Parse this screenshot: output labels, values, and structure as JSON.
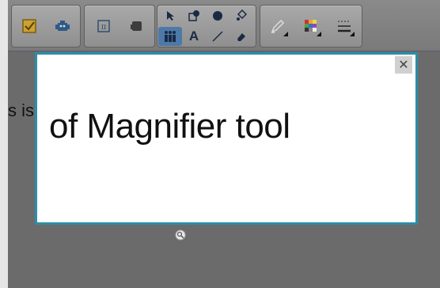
{
  "background": {
    "partial_text": "s is"
  },
  "magnifier": {
    "text": "of Magnifier tool",
    "close_symbol": "✕"
  },
  "toolbar": {
    "groups": [
      {
        "name": "check-group",
        "icons": [
          "checkbox-icon",
          "robot-icon"
        ]
      },
      {
        "name": "math-group",
        "icons": [
          "pi-icon",
          "stamp-icon"
        ]
      },
      {
        "name": "draw-group",
        "icons": [
          "pointer-icon",
          "shape-icon",
          "fill-shape-icon",
          "fill-bucket-icon",
          "people-icon",
          "text-icon",
          "line-icon",
          "eraser-icon"
        ],
        "active": "people-icon",
        "text_label": "A"
      },
      {
        "name": "style-group",
        "icons": [
          "pen-icon",
          "color-palette-icon",
          "line-style-icon"
        ]
      }
    ]
  },
  "colors": {
    "toolbar": "#8a8a8a",
    "overlay": "#6b6b6b",
    "magnifier_border": "#2a8fa6",
    "active_tool": "#4d79a8"
  }
}
